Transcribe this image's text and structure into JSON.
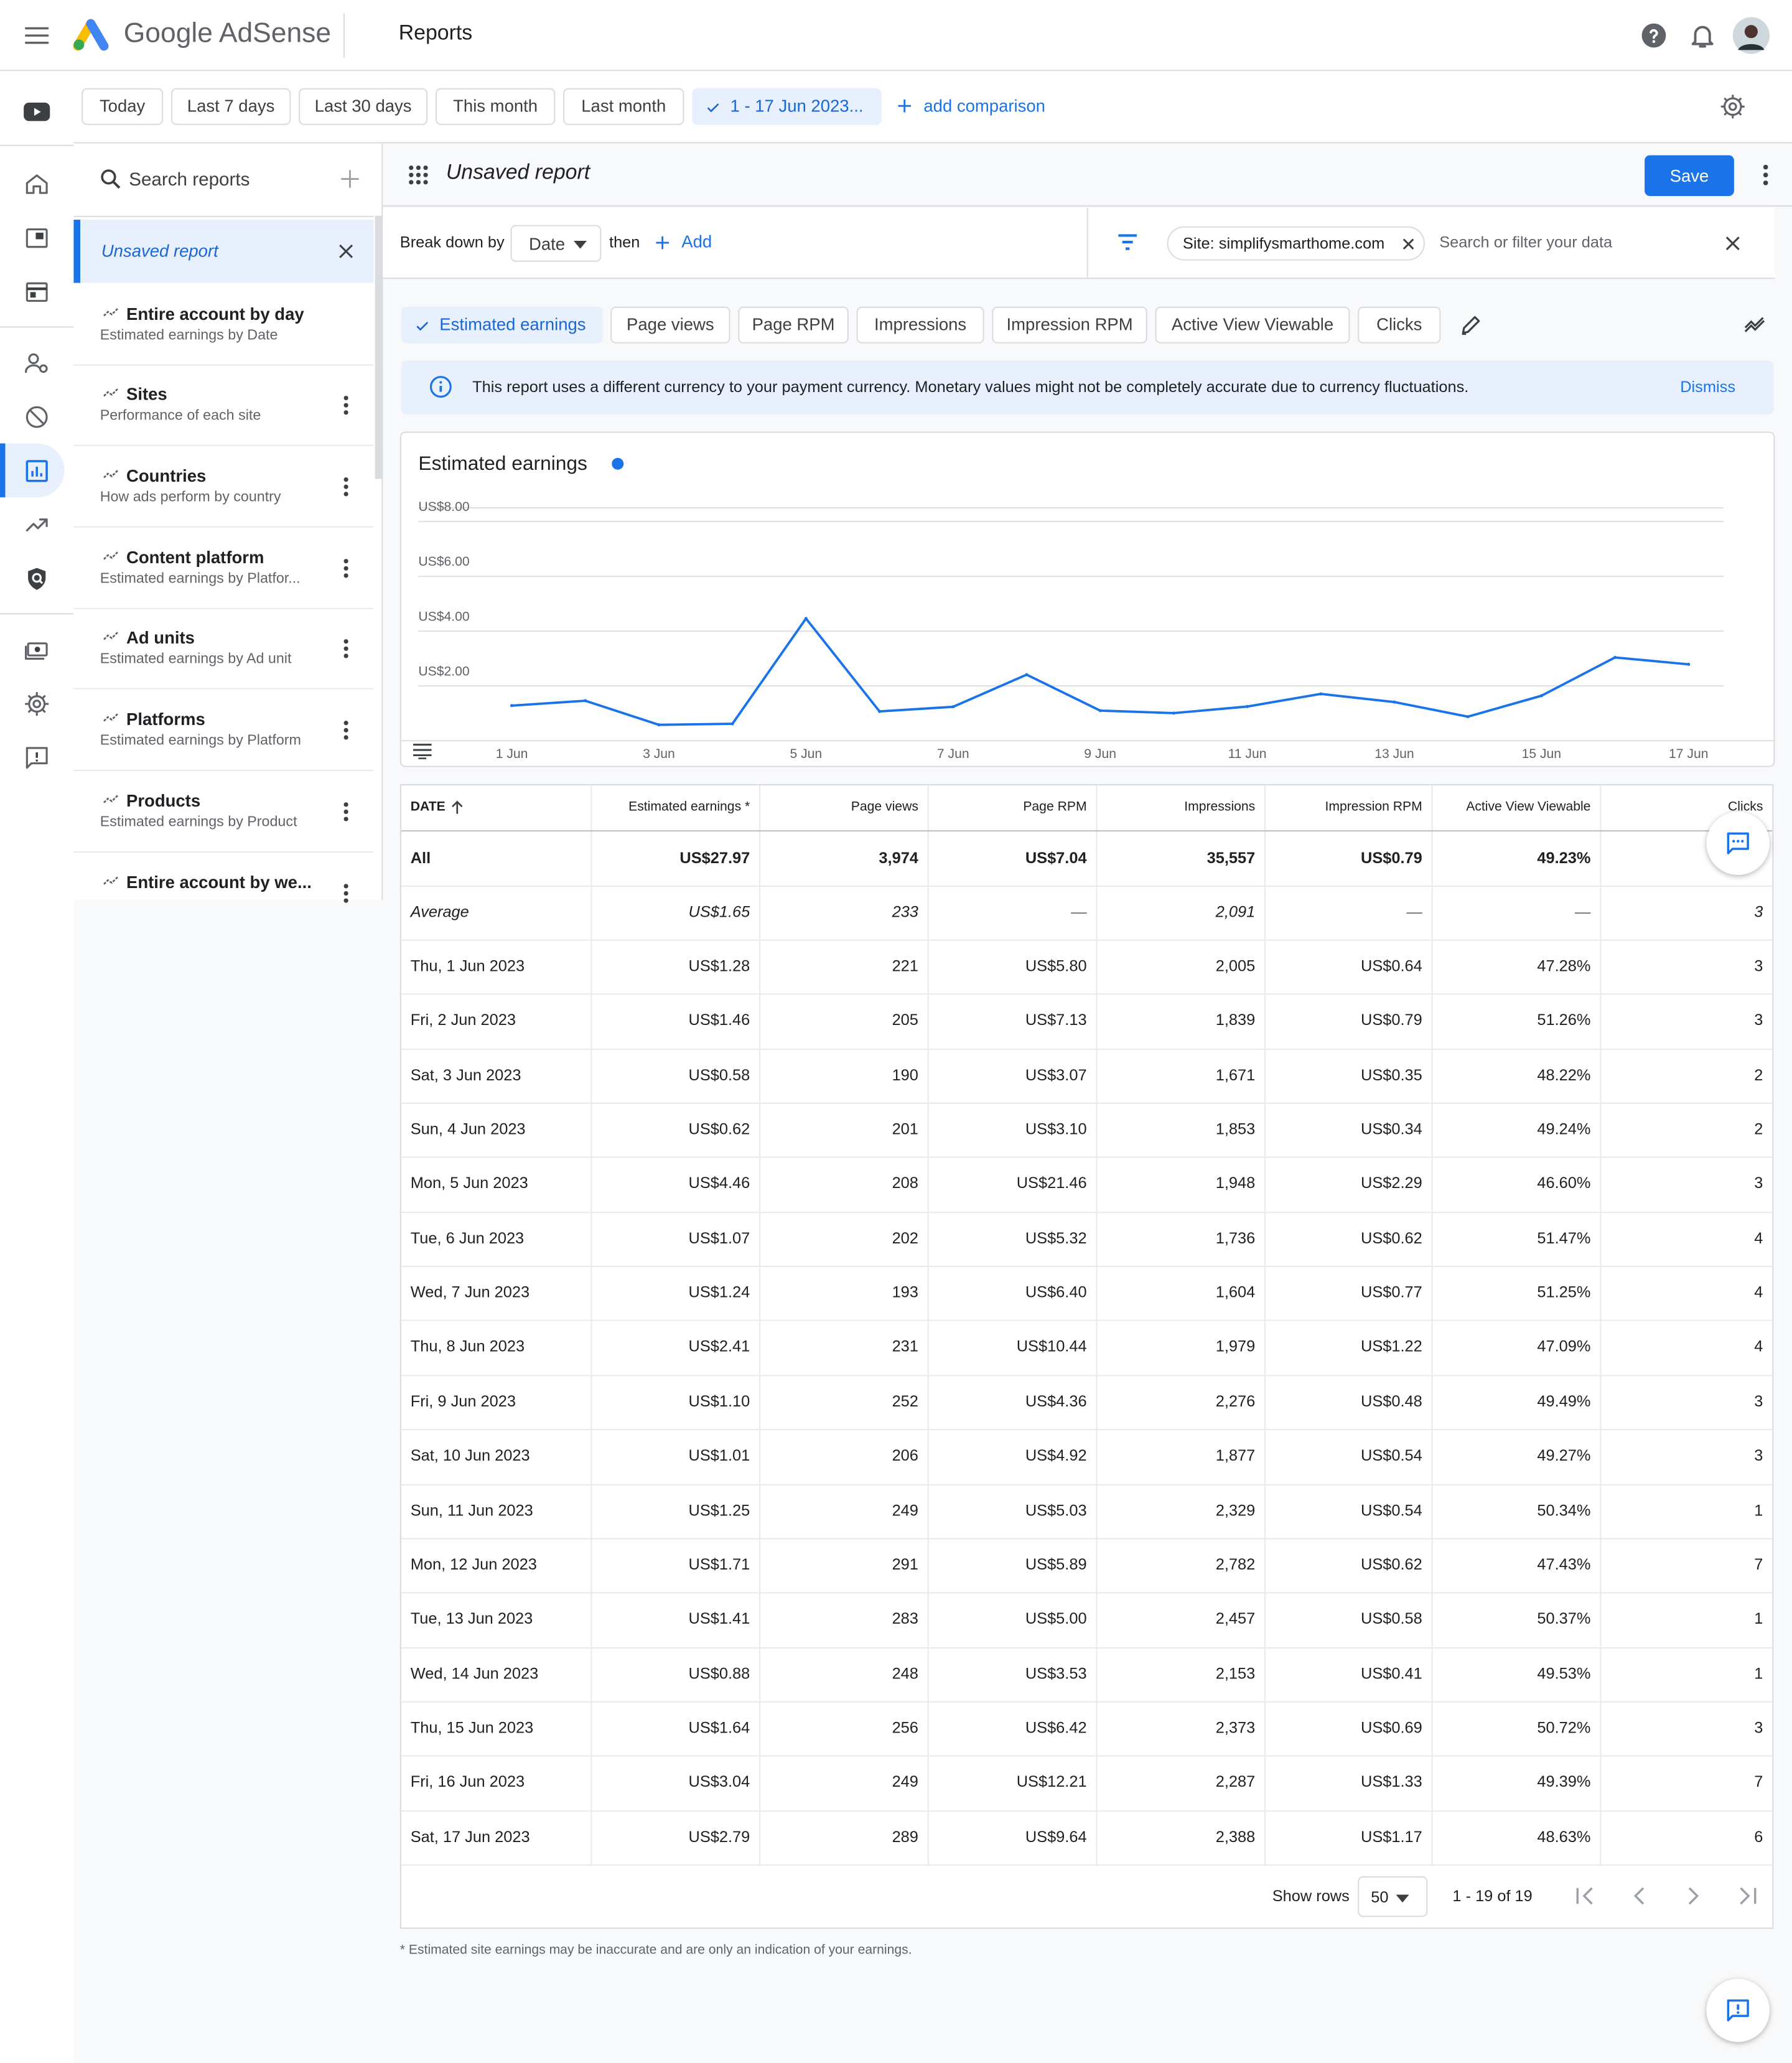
{
  "header": {
    "brand": "Google AdSense",
    "page_title": "Reports"
  },
  "date_range": {
    "presets": [
      "Today",
      "Last 7 days",
      "Last 30 days",
      "This month",
      "Last month"
    ],
    "active": "1 - 17 Jun 2023...",
    "add_comparison": "add comparison"
  },
  "sidebar": {
    "search_label": "Search reports",
    "active_report": "Unsaved report",
    "reports": [
      {
        "title": "Entire account by day",
        "subtitle": "Estimated earnings by Date"
      },
      {
        "title": "Sites",
        "subtitle": "Performance of each site"
      },
      {
        "title": "Countries",
        "subtitle": "How ads perform by country"
      },
      {
        "title": "Content platform",
        "subtitle": "Estimated earnings by Platfor..."
      },
      {
        "title": "Ad units",
        "subtitle": "Estimated earnings by Ad unit"
      },
      {
        "title": "Platforms",
        "subtitle": "Estimated earnings by Platform"
      },
      {
        "title": "Products",
        "subtitle": "Estimated earnings by Product"
      },
      {
        "title": "Entire account by we...",
        "subtitle": ""
      }
    ]
  },
  "report": {
    "title": "Unsaved report",
    "save_label": "Save",
    "breakdown_label": "Break down by",
    "breakdown_value": "Date",
    "then_label": "then",
    "add_label": "Add",
    "filter_chip": "Site: simplifysmarthome.com",
    "filter_placeholder": "Search or filter your data"
  },
  "metrics": [
    "Estimated earnings",
    "Page views",
    "Page RPM",
    "Impressions",
    "Impression RPM",
    "Active View Viewable",
    "Clicks"
  ],
  "notice": {
    "text": "This report uses a different currency to your payment currency. Monetary values might not be completely accurate due to currency fluctuations.",
    "dismiss": "Dismiss"
  },
  "chart_data": {
    "type": "line",
    "title": "Estimated earnings",
    "x": [
      "1 Jun",
      "2 Jun",
      "3 Jun",
      "4 Jun",
      "5 Jun",
      "6 Jun",
      "7 Jun",
      "8 Jun",
      "9 Jun",
      "10 Jun",
      "11 Jun",
      "12 Jun",
      "13 Jun",
      "14 Jun",
      "15 Jun",
      "16 Jun",
      "17 Jun"
    ],
    "x_tick_labels": [
      "1 Jun",
      "3 Jun",
      "5 Jun",
      "7 Jun",
      "9 Jun",
      "11 Jun",
      "13 Jun",
      "15 Jun",
      "17 Jun"
    ],
    "series": [
      {
        "name": "Estimated earnings",
        "values": [
          1.28,
          1.46,
          0.58,
          0.62,
          4.46,
          1.07,
          1.24,
          2.41,
          1.1,
          1.01,
          1.25,
          1.71,
          1.41,
          0.88,
          1.64,
          3.04,
          2.79
        ]
      }
    ],
    "y_tick_labels": [
      "US$2.00",
      "US$4.00",
      "US$6.00",
      "US$8.00"
    ],
    "ylim": [
      0,
      8.5
    ],
    "grid": true,
    "color": "#1a73e8"
  },
  "table": {
    "columns": [
      "DATE",
      "Estimated earnings *",
      "Page views",
      "Page RPM",
      "Impressions",
      "Impression RPM",
      "Active View Viewable",
      "Clicks"
    ],
    "total": [
      "All",
      "US$27.97",
      "3,974",
      "US$7.04",
      "35,557",
      "US$0.79",
      "49.23%",
      ""
    ],
    "average": [
      "Average",
      "US$1.65",
      "233",
      "—",
      "2,091",
      "—",
      "—",
      "3"
    ],
    "rows": [
      [
        "Thu, 1 Jun 2023",
        "US$1.28",
        "221",
        "US$5.80",
        "2,005",
        "US$0.64",
        "47.28%",
        "3"
      ],
      [
        "Fri, 2 Jun 2023",
        "US$1.46",
        "205",
        "US$7.13",
        "1,839",
        "US$0.79",
        "51.26%",
        "3"
      ],
      [
        "Sat, 3 Jun 2023",
        "US$0.58",
        "190",
        "US$3.07",
        "1,671",
        "US$0.35",
        "48.22%",
        "2"
      ],
      [
        "Sun, 4 Jun 2023",
        "US$0.62",
        "201",
        "US$3.10",
        "1,853",
        "US$0.34",
        "49.24%",
        "2"
      ],
      [
        "Mon, 5 Jun 2023",
        "US$4.46",
        "208",
        "US$21.46",
        "1,948",
        "US$2.29",
        "46.60%",
        "3"
      ],
      [
        "Tue, 6 Jun 2023",
        "US$1.07",
        "202",
        "US$5.32",
        "1,736",
        "US$0.62",
        "51.47%",
        "4"
      ],
      [
        "Wed, 7 Jun 2023",
        "US$1.24",
        "193",
        "US$6.40",
        "1,604",
        "US$0.77",
        "51.25%",
        "4"
      ],
      [
        "Thu, 8 Jun 2023",
        "US$2.41",
        "231",
        "US$10.44",
        "1,979",
        "US$1.22",
        "47.09%",
        "4"
      ],
      [
        "Fri, 9 Jun 2023",
        "US$1.10",
        "252",
        "US$4.36",
        "2,276",
        "US$0.48",
        "49.49%",
        "3"
      ],
      [
        "Sat, 10 Jun 2023",
        "US$1.01",
        "206",
        "US$4.92",
        "1,877",
        "US$0.54",
        "49.27%",
        "3"
      ],
      [
        "Sun, 11 Jun 2023",
        "US$1.25",
        "249",
        "US$5.03",
        "2,329",
        "US$0.54",
        "50.34%",
        "1"
      ],
      [
        "Mon, 12 Jun 2023",
        "US$1.71",
        "291",
        "US$5.89",
        "2,782",
        "US$0.62",
        "47.43%",
        "7"
      ],
      [
        "Tue, 13 Jun 2023",
        "US$1.41",
        "283",
        "US$5.00",
        "2,457",
        "US$0.58",
        "50.37%",
        "1"
      ],
      [
        "Wed, 14 Jun 2023",
        "US$0.88",
        "248",
        "US$3.53",
        "2,153",
        "US$0.41",
        "49.53%",
        "1"
      ],
      [
        "Thu, 15 Jun 2023",
        "US$1.64",
        "256",
        "US$6.42",
        "2,373",
        "US$0.69",
        "50.72%",
        "3"
      ],
      [
        "Fri, 16 Jun 2023",
        "US$3.04",
        "249",
        "US$12.21",
        "2,287",
        "US$1.33",
        "49.39%",
        "7"
      ],
      [
        "Sat, 17 Jun 2023",
        "US$2.79",
        "289",
        "US$9.64",
        "2,388",
        "US$1.17",
        "48.63%",
        "6"
      ]
    ]
  },
  "pagination": {
    "show_rows_label": "Show rows",
    "rows_value": "50",
    "range": "1 - 19 of 19"
  },
  "footnote": "* Estimated site earnings may be inaccurate and are only an indication of your earnings.",
  "colors": {
    "accent": "#1a73e8",
    "accent_light": "#e8f0fe",
    "notice_bg": "#e8f0fe",
    "logo_yellow": "#fbbc04",
    "logo_blue": "#4285f4",
    "logo_green": "#34a853"
  }
}
